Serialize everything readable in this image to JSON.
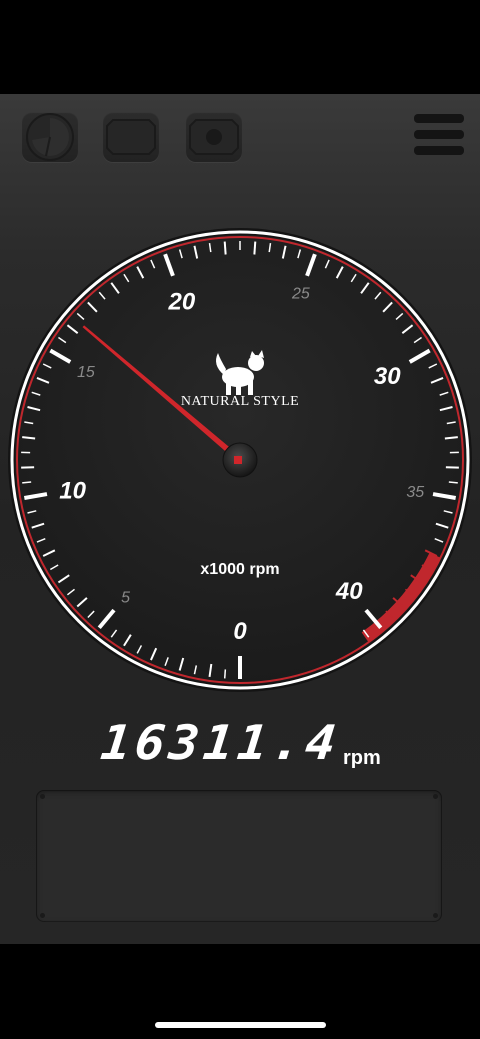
{
  "toolbar": {
    "buttons": [
      "gauge-icon",
      "screen-icon",
      "record-icon"
    ],
    "menu_icon": "hamburger-menu-icon"
  },
  "gauge": {
    "min": 0,
    "max": 45,
    "major_labels": [
      "0",
      "10",
      "20",
      "30",
      "40"
    ],
    "minor_labels": [
      "5",
      "15",
      "25",
      "35"
    ],
    "redline_from": 37,
    "needle_value": 16.3114,
    "brand": "NATURAL STYLE",
    "brand_logo": "cat-logo",
    "unit_label": "x1000 rpm",
    "colors": {
      "rim": "#ffffff",
      "redline": "#c0272d",
      "needle": "#d0262b",
      "face": "#1f1f1f"
    }
  },
  "readout": {
    "value": "16311.4",
    "unit": "rpm"
  }
}
